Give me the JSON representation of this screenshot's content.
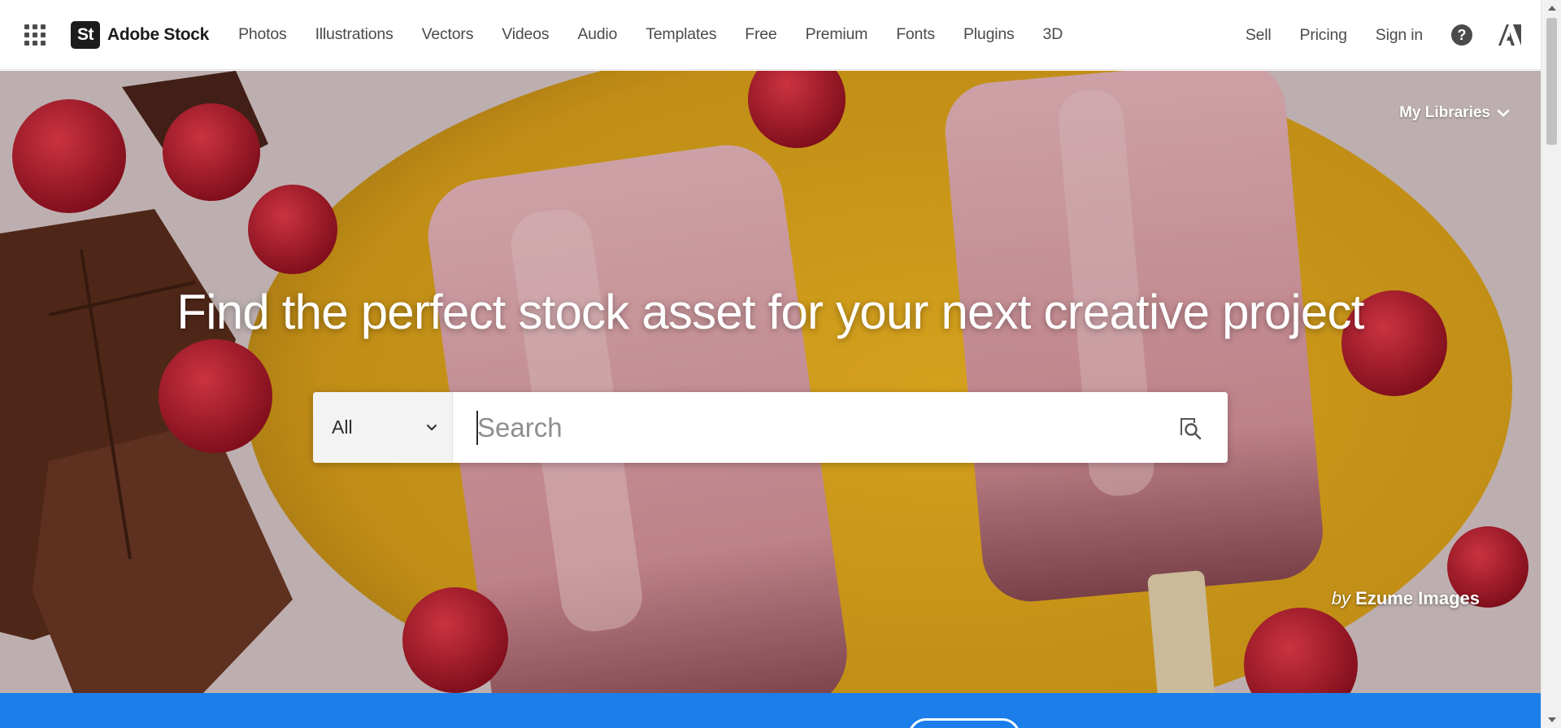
{
  "brand": {
    "badge": "St",
    "name": "Adobe Stock"
  },
  "nav": {
    "links": [
      "Photos",
      "Illustrations",
      "Vectors",
      "Videos",
      "Audio",
      "Templates",
      "Free",
      "Premium",
      "Fonts",
      "Plugins",
      "3D"
    ],
    "right": {
      "sell": "Sell",
      "pricing": "Pricing",
      "sign_in": "Sign in",
      "help": "?"
    }
  },
  "hero": {
    "my_libraries": "My Libraries",
    "title": "Find the perfect stock asset for your next creative project",
    "search": {
      "category": "All",
      "placeholder": "Search",
      "value": ""
    },
    "attribution": {
      "by": "by",
      "author": "Ezume Images"
    }
  },
  "icons": {
    "app_switcher": "app-grid-icon",
    "help": "help-circle-icon",
    "adobe": "adobe-logo-icon",
    "libraries_chevron": "chevron-down-icon",
    "category_chevron": "chevron-down-icon",
    "visual_search": "visual-search-icon"
  },
  "colors": {
    "brand_dark": "#1c1c1c",
    "nav_text": "#4b4b4b",
    "promo_blue": "#1b7eea",
    "hero_yellow": "#d9a21a"
  }
}
